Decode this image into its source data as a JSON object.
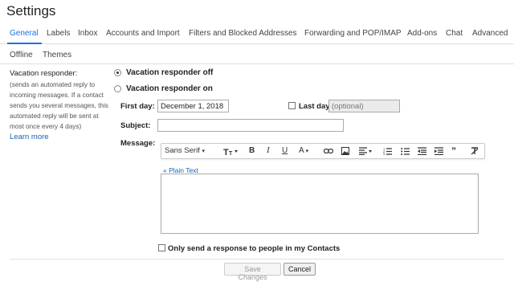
{
  "window": {
    "title": "Settings"
  },
  "tabs": [
    {
      "label": "General",
      "active": true
    },
    {
      "label": "Labels"
    },
    {
      "label": "Inbox"
    },
    {
      "label": "Accounts and Import"
    },
    {
      "label": "Filters and Blocked Addresses"
    },
    {
      "label": "Forwarding and POP/IMAP"
    },
    {
      "label": "Add-ons"
    },
    {
      "label": "Chat"
    },
    {
      "label": "Advanced"
    },
    {
      "label": "Offline"
    },
    {
      "label": "Themes"
    }
  ],
  "accent": "#1a73e8",
  "vacation": {
    "heading": "Vacation responder:",
    "desc": "(sends an automated reply to incoming messages. If a contact sends you several messages, this automated reply will be sent at most once every 4 days)",
    "learn_more": "Learn more",
    "off_label": "Vacation responder off",
    "on_label": "Vacation responder on",
    "selected": "off",
    "first_day_label": "First day:",
    "first_day_value": "December 1, 2018",
    "last_day_label": "Last day:",
    "last_day_placeholder": "(optional)",
    "subject_label": "Subject:",
    "subject_value": "",
    "message_label": "Message:",
    "font_select": "Sans Serif",
    "plain_text_link": "« Plain Text",
    "contacts_only_label": "Only send a response to people in my Contacts"
  },
  "toolbar_icons": [
    "font-family-select",
    "font-size-icon",
    "bold-icon",
    "italic-icon",
    "underline-icon",
    "text-color-icon",
    "link-icon",
    "image-icon",
    "align-icon",
    "numbered-list-icon",
    "bulleted-list-icon",
    "indent-less-icon",
    "indent-more-icon",
    "quote-icon",
    "remove-formatting-icon"
  ],
  "buttons": {
    "save": "Save Changes",
    "cancel": "Cancel"
  }
}
